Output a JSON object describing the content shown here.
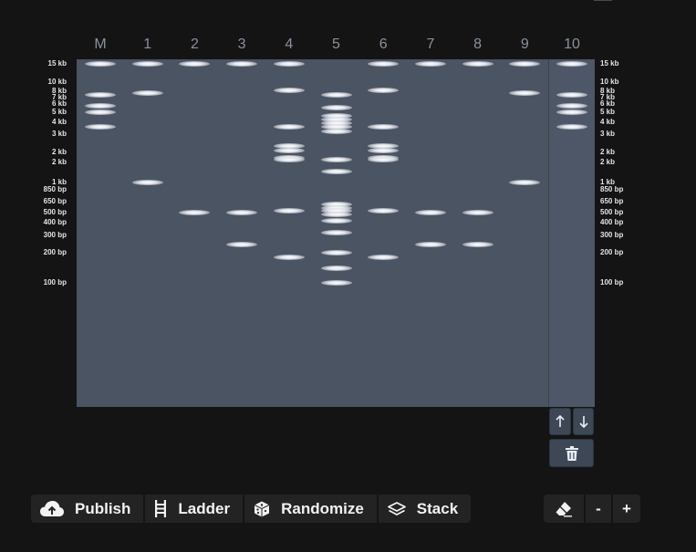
{
  "lanes": {
    "labels": [
      "M",
      "1",
      "2",
      "3",
      "4",
      "5",
      "6",
      "7",
      "8",
      "9",
      "10"
    ],
    "selected_index": 10,
    "bands": [
      [
        15000,
        7500,
        5800,
        5000,
        3600
      ],
      [
        15000,
        7700,
        1000
      ],
      [
        15000,
        500
      ],
      [
        15000,
        500,
        240
      ],
      [
        15000,
        8200,
        3600,
        2300,
        2100,
        1750,
        1700,
        530,
        180
      ],
      [
        7500,
        5500,
        4600,
        4200,
        3900,
        3600,
        3200,
        1700,
        1300,
        610,
        560,
        520,
        480,
        420,
        320,
        200,
        140,
        100
      ],
      [
        15000,
        8200,
        3600,
        2300,
        2100,
        1750,
        1700,
        530,
        180
      ],
      [
        15000,
        500,
        240
      ],
      [
        15000,
        500,
        240
      ],
      [
        15000,
        7700,
        1000
      ],
      [
        15000,
        7500,
        5800,
        5000,
        3600
      ]
    ]
  },
  "ladder_axis": [
    {
      "bp": 15000,
      "label": "15 kb"
    },
    {
      "bp": 10000,
      "label": "10 kb"
    },
    {
      "bp": 8000,
      "label": "8 kb"
    },
    {
      "bp": 7000,
      "label": "7 kb"
    },
    {
      "bp": 6000,
      "label": "6 kb"
    },
    {
      "bp": 5000,
      "label": "5 kb"
    },
    {
      "bp": 4000,
      "label": "4 kb"
    },
    {
      "bp": 3000,
      "label": "3 kb"
    },
    {
      "bp": 2000,
      "label": "2 kb"
    },
    {
      "bp": 1600,
      "label": "2 kb"
    },
    {
      "bp": 1000,
      "label": "1 kb"
    },
    {
      "bp": 850,
      "label": "850 bp"
    },
    {
      "bp": 650,
      "label": "650 bp"
    },
    {
      "bp": 500,
      "label": "500 bp"
    },
    {
      "bp": 400,
      "label": "400 bp"
    },
    {
      "bp": 300,
      "label": "300 bp"
    },
    {
      "bp": 200,
      "label": "200 bp"
    },
    {
      "bp": 100,
      "label": "100 bp"
    }
  ],
  "lane_controls": {
    "up_icon": "arrow-up-icon",
    "down_icon": "arrow-down-icon",
    "delete_icon": "trash-icon"
  },
  "toolbar": {
    "publish_label": "Publish",
    "ladder_label": "Ladder",
    "randomize_label": "Randomize",
    "stack_label": "Stack",
    "publish_icon": "cloud-upload-icon",
    "ladder_icon": "ladder-icon",
    "randomize_icon": "dice-icon",
    "stack_icon": "layers-icon"
  },
  "zoom": {
    "eraser_icon": "eraser-icon",
    "minus_label": "-",
    "plus_label": "+"
  },
  "colors": {
    "background": "#141414",
    "gel": "#4b5463",
    "band": "#ffffff",
    "toolbar": "#232323",
    "lane_button": "#3d4756"
  }
}
